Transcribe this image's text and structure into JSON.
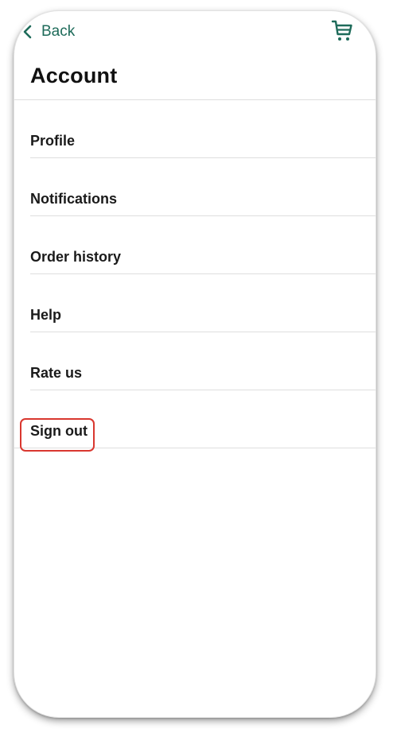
{
  "nav": {
    "back_label": "Back",
    "back_icon": "chevron-left-icon",
    "cart_icon": "cart-icon"
  },
  "page": {
    "title": "Account"
  },
  "menu": {
    "items": [
      {
        "label": "Profile"
      },
      {
        "label": "Notifications"
      },
      {
        "label": "Order history"
      },
      {
        "label": "Help"
      },
      {
        "label": "Rate us"
      },
      {
        "label": "Sign out"
      }
    ]
  },
  "colors": {
    "accent": "#1e6b5a",
    "highlight": "#d9372f",
    "divider": "#dedede",
    "text": "#1a1a1a"
  }
}
